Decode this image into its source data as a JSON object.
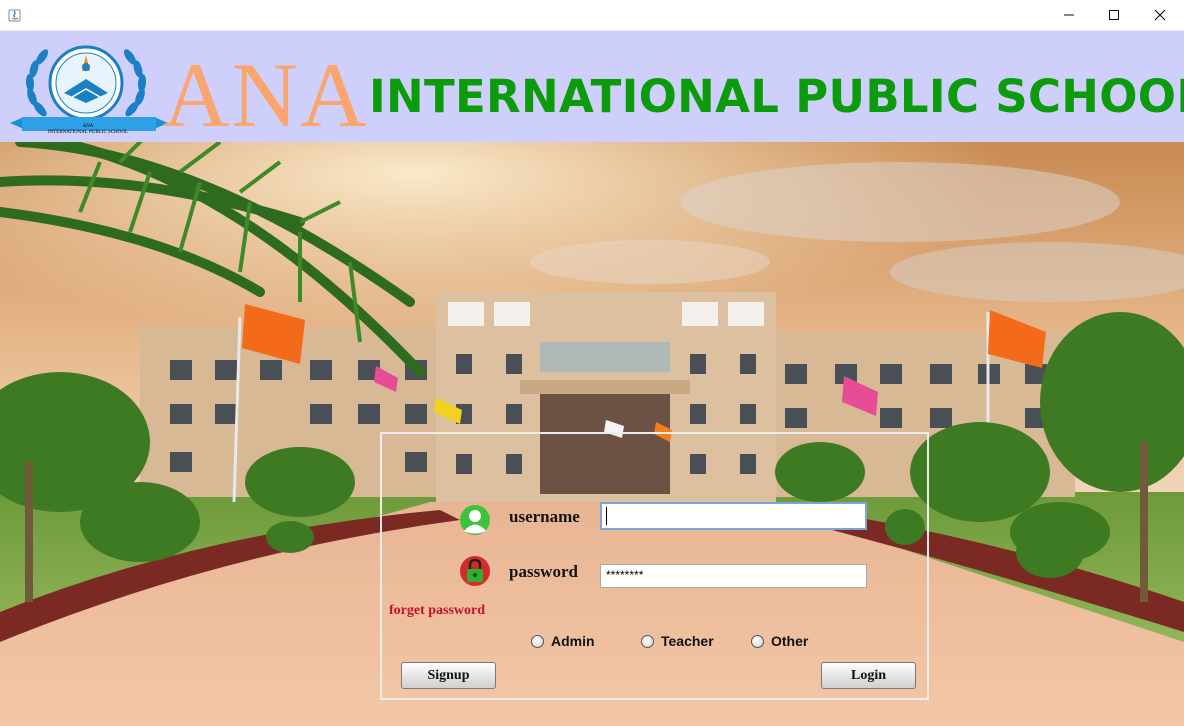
{
  "window": {
    "app_icon": "java-icon",
    "controls": [
      "minimize-icon",
      "maximize-icon",
      "close-icon"
    ]
  },
  "header": {
    "logo_text_line1": "ANA",
    "logo_text_line2": "INTERNATIONAL PUBLIC SCHOOL",
    "school_short": "ANA",
    "school_long": "INTERNATIONAL PUBLIC SCHOOL",
    "background_color": "#cfcffb",
    "short_color": "#f9a56d",
    "long_color": "#0b9b0b"
  },
  "login": {
    "username_label": "username",
    "username_value": "",
    "password_label": "password",
    "password_value": "********",
    "forget_password": "forget password",
    "roles": [
      {
        "label": "Admin",
        "selected": false
      },
      {
        "label": "Teacher",
        "selected": false
      },
      {
        "label": "Other",
        "selected": false
      }
    ],
    "signup_label": "Signup",
    "login_label": "Login",
    "user_icon": "user-avatar-icon",
    "lock_icon": "lock-icon"
  }
}
